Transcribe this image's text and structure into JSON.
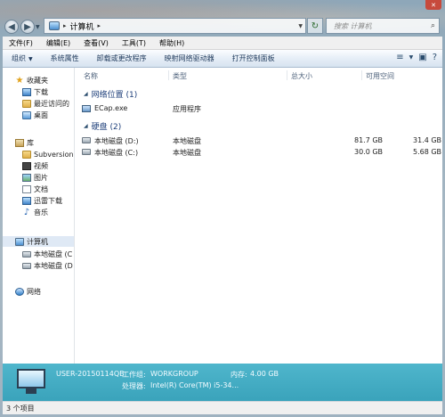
{
  "address": {
    "crumb": "计算机",
    "separator": "▸"
  },
  "search": {
    "placeholder": "搜索 计算机"
  },
  "menu": [
    "文件(F)",
    "编辑(E)",
    "查看(V)",
    "工具(T)",
    "帮助(H)"
  ],
  "toolbar": {
    "organize": "组织",
    "items": [
      "系统属性",
      "卸载或更改程序",
      "映射网络驱动器",
      "打开控制面板"
    ]
  },
  "nav": {
    "favorites": {
      "label": "收藏夹",
      "items": [
        "下载",
        "最近访问的",
        "桌面"
      ]
    },
    "libraries": {
      "label": "库",
      "items": [
        "Subversion",
        "视频",
        "图片",
        "文档",
        "迅雷下载",
        "音乐"
      ]
    },
    "computer": {
      "label": "计算机",
      "items": [
        "本地磁盘 (C",
        "本地磁盘 (D"
      ]
    },
    "network": {
      "label": "网络"
    }
  },
  "columns": {
    "name": "名称",
    "type": "类型",
    "total": "总大小",
    "free": "可用空间"
  },
  "groups": [
    {
      "label": "网络位置 (1)",
      "rows": [
        {
          "name": "ECap.exe",
          "type": "应用程序",
          "total": "",
          "free": ""
        }
      ]
    },
    {
      "label": "硬盘 (2)",
      "rows": [
        {
          "name": "本地磁盘 (D:)",
          "type": "本地磁盘",
          "total": "81.7 GB",
          "free": "31.4 GB"
        },
        {
          "name": "本地磁盘 (C:)",
          "type": "本地磁盘",
          "total": "30.0 GB",
          "free": "5.68 GB"
        }
      ]
    }
  ],
  "details": {
    "computer_name": "USER-20150114QB",
    "workgroup_label": "工作组:",
    "workgroup": "WORKGROUP",
    "memory_label": "内存:",
    "memory": "4.00 GB",
    "cpu_label": "处理器:",
    "cpu": "Intel(R) Core(TM) i5-34..."
  },
  "status": {
    "items_count": "3 个项目"
  }
}
